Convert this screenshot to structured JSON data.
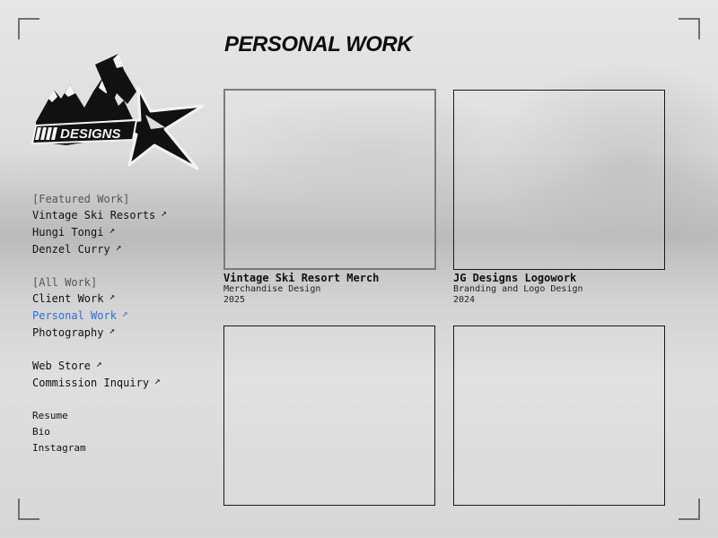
{
  "brand": {
    "logo_text": "DESIGNS"
  },
  "page": {
    "title": "PERSONAL WORK"
  },
  "nav": {
    "featured_heading": "[Featured Work]",
    "featured": [
      {
        "label": "Vintage Ski Resorts"
      },
      {
        "label": "Hungi Tongi"
      },
      {
        "label": "Denzel Curry"
      }
    ],
    "all_heading": "[All Work]",
    "all": [
      {
        "label": "Client Work"
      },
      {
        "label": "Personal Work"
      },
      {
        "label": "Photography"
      }
    ],
    "shop": [
      {
        "label": "Web Store"
      },
      {
        "label": "Commission Inquiry"
      }
    ],
    "links": [
      {
        "label": "Resume"
      },
      {
        "label": "Bio"
      },
      {
        "label": "Instagram"
      }
    ],
    "arrow_glyph": "↗"
  },
  "projects": [
    {
      "title": "Vintage Ski Resort Merch",
      "category": "Merchandise Design",
      "year": "2025"
    },
    {
      "title": "JG Designs Logowork",
      "category": "Branding and Logo Design",
      "year": "2024"
    }
  ],
  "colors": {
    "active_link": "#2a6fd6",
    "text": "#111111"
  }
}
